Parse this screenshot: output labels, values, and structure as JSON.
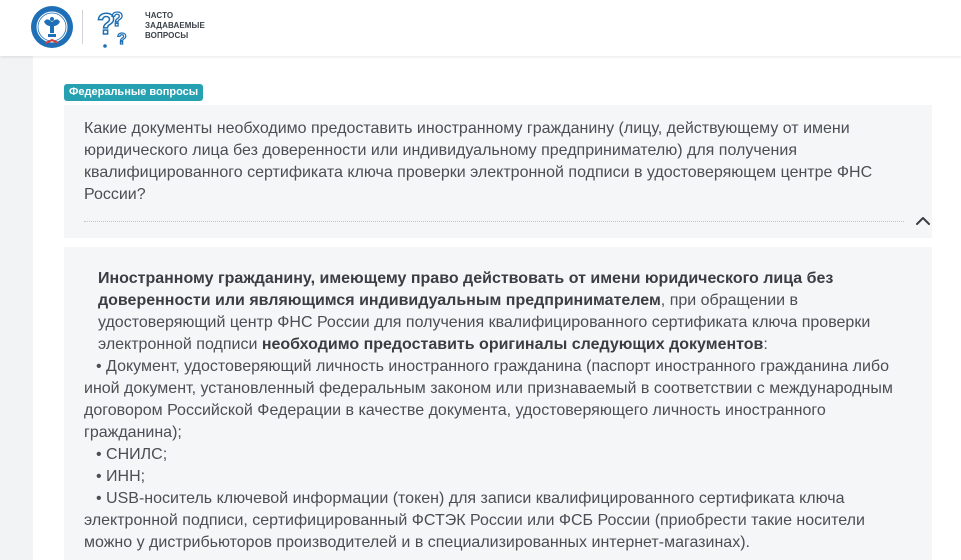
{
  "header": {
    "logo_name": "fns-emblem",
    "faq_icon": "question-marks-icon",
    "logo_text_lines": [
      "ЧАСТО",
      "ЗАДАВАЕМЫЕ",
      "ВОПРОСЫ"
    ]
  },
  "colors": {
    "badge_bg": "#26a1b1",
    "page_bg": "#f2f3f4",
    "card_bg": "#f5f6f7",
    "fns_blue": "#1e6fb5"
  },
  "badge": {
    "label": "Федеральные вопросы"
  },
  "question": {
    "text": "Какие документы необходимо предоставить иностранному гражданину (лицу, действующему от имени юридического лица без доверенности или индивидуальному предпринимателю) для получения квалифицированного сертификата ключа проверки электронной подписи в удостоверяющем центре ФНС России?",
    "toggle_icon": "chevron-up-icon"
  },
  "answer": {
    "intro_bold": "Иностранному гражданину, имеющему право действовать от имени юридического лица без доверенности или являющимся индивидуальным предпринимателем",
    "intro_plain": ", при обращении в удостоверяющий центр ФНС России для получения квалифицированного сертификата ключа проверки электронной подписи ",
    "intro_bold2": "необходимо предоставить оригиналы следующих документов",
    "intro_colon": ":",
    "items": [
      "• Документ, удостоверяющий личность иностранного гражданина (паспорт иностранного гражданина либо иной документ, установленный федеральным законом или признаваемый в соответствии с международным договором Российской Федерации в качестве документа, удостоверяющего личность иностранного гражданина);",
      "• СНИЛС;",
      "• ИНН;",
      "• USB-носитель ключевой информации (токен) для записи квалифицированного сертификата ключа электронной подписи, сертифицированный ФСТЭК России или ФСБ России (приобрести такие носители можно у дистрибьюторов производителей и в специализированных интернет-магазинах)."
    ]
  }
}
